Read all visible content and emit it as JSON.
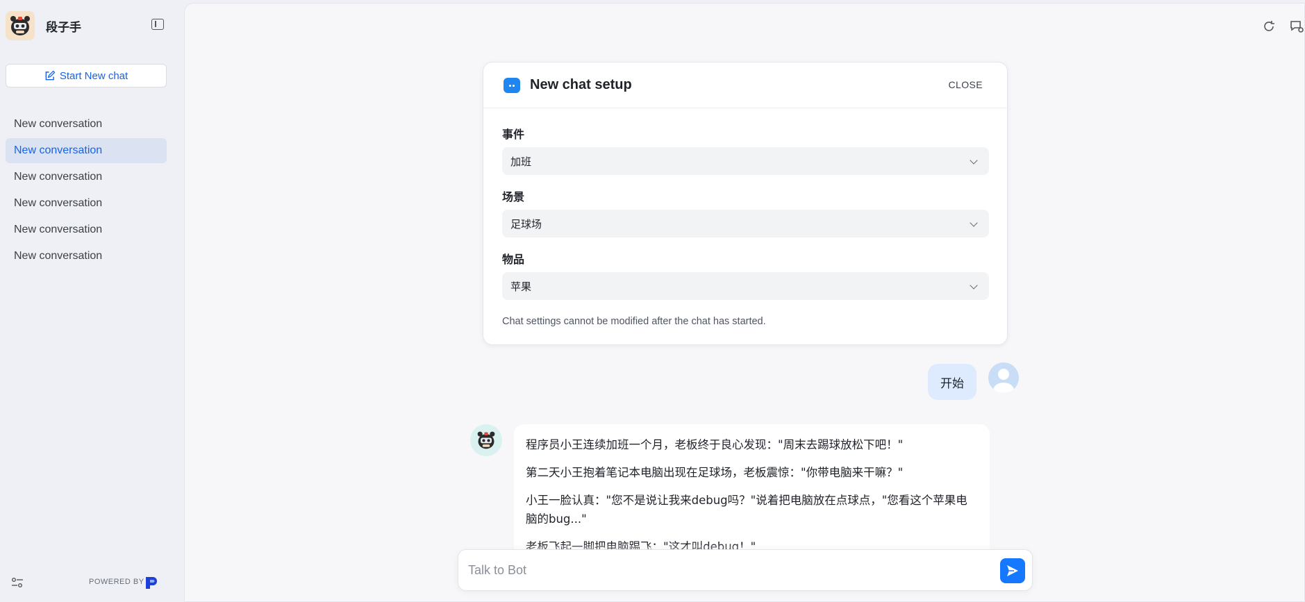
{
  "sidebar": {
    "bot_name": "段子手",
    "new_chat_label": "Start New chat",
    "conversations": [
      {
        "label": "New conversation",
        "active": false
      },
      {
        "label": "New conversation",
        "active": true
      },
      {
        "label": "New conversation",
        "active": false
      },
      {
        "label": "New conversation",
        "active": false
      },
      {
        "label": "New conversation",
        "active": false
      },
      {
        "label": "New conversation",
        "active": false
      }
    ],
    "powered_by": "POWERED BY"
  },
  "setup": {
    "title": "New chat setup",
    "close_label": "CLOSE",
    "fields": [
      {
        "label": "事件",
        "value": "加班"
      },
      {
        "label": "场景",
        "value": "足球场"
      },
      {
        "label": "物品",
        "value": "苹果"
      }
    ],
    "note": "Chat settings cannot be modified after the chat has started."
  },
  "messages": {
    "user_text": "开始",
    "bot_paragraphs": [
      "程序员小王连续加班一个月，老板终于良心发现：\"周末去踢球放松下吧！\"",
      "第二天小王抱着笔记本电脑出现在足球场，老板震惊：\"你带电脑来干嘛？\"",
      "小王一脸认真：\"您不是说让我来debug吗？\"说着把电脑放在点球点，\"您看这个苹果电脑的bug...\"",
      "老板飞起一脚把电脑踢飞：\"这才叫debug！\""
    ]
  },
  "composer": {
    "placeholder": "Talk to Bot"
  },
  "colors": {
    "accent": "#1763e5",
    "send_button": "#1677ff",
    "active_item_bg": "#dbe3f3",
    "user_bubble_bg": "#deebff"
  },
  "icons": [
    "bot-logo-icon",
    "sidebar-collapse-icon",
    "edit-icon",
    "settings-sliders-icon",
    "refresh-icon",
    "chat-settings-icon",
    "chevron-down-icon",
    "send-icon"
  ]
}
